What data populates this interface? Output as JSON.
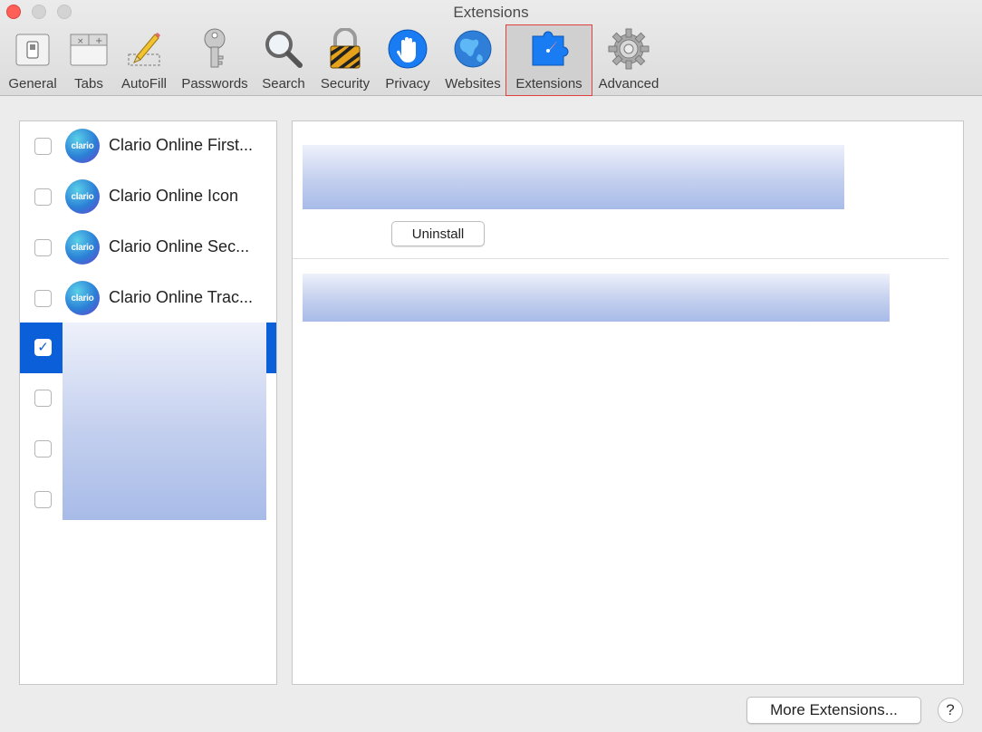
{
  "window": {
    "title": "Extensions"
  },
  "toolbar": {
    "items": [
      {
        "label": "General",
        "icon": "general-switch-icon"
      },
      {
        "label": "Tabs",
        "icon": "tabs-icon"
      },
      {
        "label": "AutoFill",
        "icon": "pencil-icon"
      },
      {
        "label": "Passwords",
        "icon": "key-icon"
      },
      {
        "label": "Search",
        "icon": "search-icon"
      },
      {
        "label": "Security",
        "icon": "padlock-icon"
      },
      {
        "label": "Privacy",
        "icon": "hand-icon"
      },
      {
        "label": "Websites",
        "icon": "globe-icon"
      },
      {
        "label": "Extensions",
        "icon": "puzzle-compass-icon",
        "selected": true
      },
      {
        "label": "Advanced",
        "icon": "gear-icon"
      }
    ]
  },
  "extensions": {
    "items": [
      {
        "label": "Clario Online First...",
        "icon_text": "clario",
        "checked": false
      },
      {
        "label": "Clario Online Icon",
        "icon_text": "clario",
        "checked": false
      },
      {
        "label": "Clario Online Sec...",
        "icon_text": "clario",
        "checked": false
      },
      {
        "label": "Clario Online Trac...",
        "icon_text": "clario",
        "checked": false
      }
    ]
  },
  "detail": {
    "uninstall_label": "Uninstall"
  },
  "footer": {
    "more_extensions_label": "More Extensions...",
    "help_label": "?"
  },
  "colors": {
    "selection": "#0b5fd8",
    "highlight_border": "#e0413f",
    "close": "#fe5f57"
  }
}
